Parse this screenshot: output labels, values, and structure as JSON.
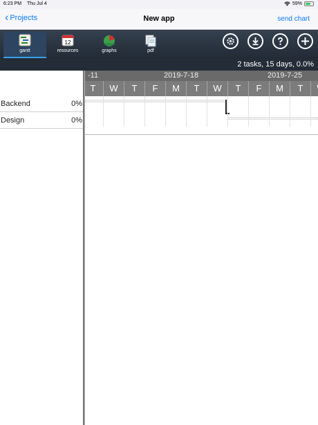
{
  "status": {
    "time": "6:23 PM",
    "date": "Thu Jul 4",
    "battery": "59%",
    "battery_level": 0.59
  },
  "nav": {
    "back_label": "Projects",
    "title": "New app",
    "action_label": "send chart"
  },
  "toolbar": {
    "tabs": [
      {
        "label": "gantt",
        "icon": "gantt-icon"
      },
      {
        "label": "resources",
        "icon": "calendar-icon",
        "icon_text": "12"
      },
      {
        "label": "graphs",
        "icon": "pie-chart-icon"
      },
      {
        "label": "pdf",
        "icon": "pdf-icon"
      }
    ],
    "buttons": [
      "settings-icon",
      "download-icon",
      "help-icon",
      "add-icon"
    ]
  },
  "summary": "2 tasks, 15 days, 0.0%",
  "tasks": [
    {
      "name": "Backend",
      "progress": "0%"
    },
    {
      "name": "Design",
      "progress": "0%"
    }
  ],
  "timeline": {
    "week_labels": [
      "-11",
      "2019-7-18",
      "2019-7-25"
    ],
    "days": [
      "T",
      "W",
      "T",
      "F",
      "M",
      "T",
      "W",
      "T",
      "F",
      "M",
      "T",
      "W"
    ]
  },
  "colors": {
    "accent": "#0a7aff",
    "toolbar_bg": "#222b36",
    "header_bg": "#6a6a6a"
  }
}
